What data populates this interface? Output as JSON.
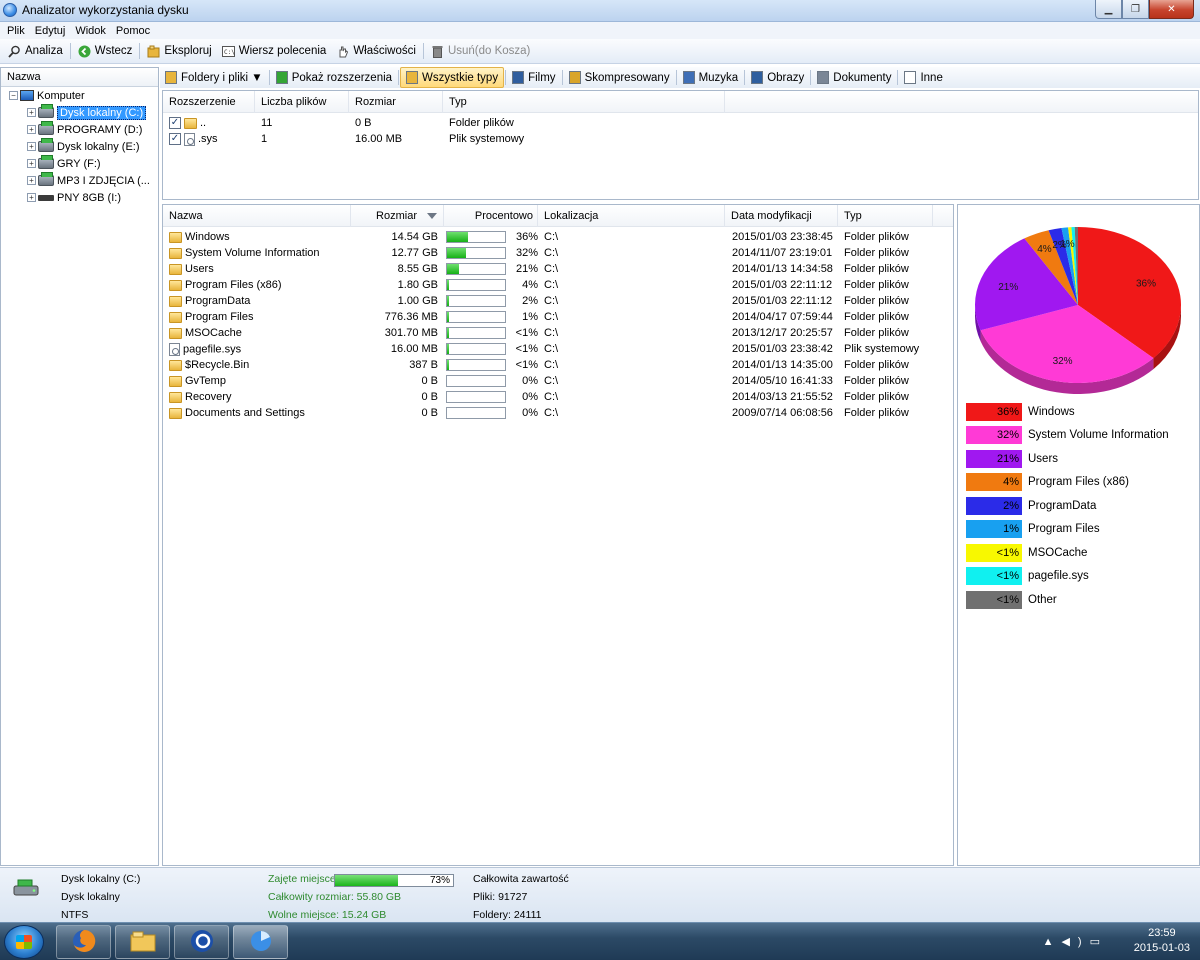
{
  "window": {
    "title": "Analizator wykorzystania dysku"
  },
  "menu": [
    "Plik",
    "Edytuj",
    "Widok",
    "Pomoc"
  ],
  "toolbar": {
    "analyze": "Analiza",
    "back": "Wstecz",
    "explore": "Eksploruj",
    "cmd": "Wiersz polecenia",
    "properties": "Właściwości",
    "delete": "Usuń(do Kosza)"
  },
  "tree": {
    "header": "Nazwa",
    "root": "Komputer",
    "drives": [
      {
        "label": "Dysk lokalny (C:)",
        "selected": true,
        "kind": "hdd"
      },
      {
        "label": "PROGRAMY (D:)",
        "selected": false,
        "kind": "hdd"
      },
      {
        "label": "Dysk lokalny (E:)",
        "selected": false,
        "kind": "hdd"
      },
      {
        "label": "GRY (F:)",
        "selected": false,
        "kind": "hdd"
      },
      {
        "label": "MP3 I ZDJĘCIA (...",
        "selected": false,
        "kind": "hdd"
      },
      {
        "label": "PNY 8GB (I:)",
        "selected": false,
        "kind": "usb"
      }
    ]
  },
  "tabs": [
    {
      "label": "Foldery i pliki ▼",
      "icon": "folder-files-icon",
      "color": "#e8b53c",
      "active": false
    },
    {
      "label": "Pokaż rozszerzenia",
      "icon": "up-arrow-icon",
      "color": "#35a535",
      "active": false
    },
    {
      "label": "Wszystkie typy",
      "icon": "folder-icon",
      "color": "#e8b53c",
      "active": true
    },
    {
      "label": "Filmy",
      "icon": "film-icon",
      "color": "#305e9e",
      "active": false
    },
    {
      "label": "Skompresowany",
      "icon": "archive-icon",
      "color": "#d9a52a",
      "active": false
    },
    {
      "label": "Muzyka",
      "icon": "music-icon",
      "color": "#3f6fb6",
      "active": false
    },
    {
      "label": "Obrazy",
      "icon": "image-icon",
      "color": "#2f5f9e",
      "active": false
    },
    {
      "label": "Dokumenty",
      "icon": "document-icon",
      "color": "#7a8696",
      "active": false
    },
    {
      "label": "Inne",
      "icon": "blank-file-icon",
      "color": "#ffffff",
      "active": false
    }
  ],
  "extensions": {
    "columns": [
      "Rozszerzenie",
      "Liczba plików",
      "Rozmiar",
      "Typ"
    ],
    "rows": [
      {
        "ext": "..",
        "count": "11",
        "size": "0 B",
        "type": "Folder plików",
        "icon": "folder-icon"
      },
      {
        "ext": ".sys",
        "count": "1",
        "size": "16.00 MB",
        "type": "Plik systemowy",
        "icon": "system-file-icon"
      }
    ]
  },
  "files": {
    "columns": [
      "Nazwa",
      "Rozmiar",
      "Procentowo",
      "Lokalizacja",
      "Data modyfikacji",
      "Typ"
    ],
    "rows": [
      {
        "name": "Windows",
        "size": "14.54 GB",
        "pct": "36%",
        "fill": 0.36,
        "loc": "C:\\",
        "date": "2015/01/03 23:38:45",
        "type": "Folder plików",
        "icon": "folder"
      },
      {
        "name": "System Volume Information",
        "size": "12.77 GB",
        "pct": "32%",
        "fill": 0.32,
        "loc": "C:\\",
        "date": "2014/11/07 23:19:01",
        "type": "Folder plików",
        "icon": "folder"
      },
      {
        "name": "Users",
        "size": "8.55 GB",
        "pct": "21%",
        "fill": 0.21,
        "loc": "C:\\",
        "date": "2014/01/13 14:34:58",
        "type": "Folder plików",
        "icon": "folder"
      },
      {
        "name": "Program Files (x86)",
        "size": "1.80 GB",
        "pct": "4%",
        "fill": 0.04,
        "loc": "C:\\",
        "date": "2015/01/03 22:11:12",
        "type": "Folder plików",
        "icon": "folder"
      },
      {
        "name": "ProgramData",
        "size": "1.00 GB",
        "pct": "2%",
        "fill": 0.02,
        "loc": "C:\\",
        "date": "2015/01/03 22:11:12",
        "type": "Folder plików",
        "icon": "folder"
      },
      {
        "name": "Program Files",
        "size": "776.36 MB",
        "pct": "1%",
        "fill": 0.01,
        "loc": "C:\\",
        "date": "2014/04/17 07:59:44",
        "type": "Folder plików",
        "icon": "folder"
      },
      {
        "name": "MSOCache",
        "size": "301.70 MB",
        "pct": "<1%",
        "fill": 0.005,
        "loc": "C:\\",
        "date": "2013/12/17 20:25:57",
        "type": "Folder plików",
        "icon": "folder"
      },
      {
        "name": "pagefile.sys",
        "size": "16.00 MB",
        "pct": "<1%",
        "fill": 0.005,
        "loc": "C:\\",
        "date": "2015/01/03 23:38:42",
        "type": "Plik systemowy",
        "icon": "file"
      },
      {
        "name": "$Recycle.Bin",
        "size": "387 B",
        "pct": "<1%",
        "fill": 0.005,
        "loc": "C:\\",
        "date": "2014/01/13 14:35:00",
        "type": "Folder plików",
        "icon": "folder"
      },
      {
        "name": "GvTemp",
        "size": "0 B",
        "pct": "0%",
        "fill": 0,
        "loc": "C:\\",
        "date": "2014/05/10 16:41:33",
        "type": "Folder plików",
        "icon": "folder"
      },
      {
        "name": "Recovery",
        "size": "0 B",
        "pct": "0%",
        "fill": 0,
        "loc": "C:\\",
        "date": "2014/03/13 21:55:52",
        "type": "Folder plików",
        "icon": "folder"
      },
      {
        "name": "Documents and Settings",
        "size": "0 B",
        "pct": "0%",
        "fill": 0,
        "loc": "C:\\",
        "date": "2009/07/14 06:08:56",
        "type": "Folder plików",
        "icon": "folder"
      }
    ]
  },
  "chart_data": {
    "type": "pie",
    "slices": [
      {
        "name": "Windows",
        "value": 36,
        "label": "36%",
        "color": "#f01818"
      },
      {
        "name": "System Volume Information",
        "value": 32,
        "label": "32%",
        "color": "#ff3ad6"
      },
      {
        "name": "Users",
        "value": 21,
        "label": "21%",
        "color": "#a018f0"
      },
      {
        "name": "Program Files (x86)",
        "value": 4,
        "label": "4%",
        "color": "#f07a10"
      },
      {
        "name": "ProgramData",
        "value": 2,
        "label": "2%",
        "color": "#2b2be8"
      },
      {
        "name": "Program Files",
        "value": 1,
        "label": "1%",
        "color": "#18a0f0"
      },
      {
        "name": "MSOCache",
        "value": 0.5,
        "label": "<1%",
        "color": "#f8f800"
      },
      {
        "name": "pagefile.sys",
        "value": 0.5,
        "label": "<1%",
        "color": "#10f0f0"
      },
      {
        "name": "Other",
        "value": 0.5,
        "label": "<1%",
        "color": "#707070"
      }
    ],
    "legend": "below"
  },
  "status": {
    "drive_name": "Dysk lokalny (C:)",
    "drive_label": "Dysk lokalny",
    "fs": "NTFS",
    "used_label": "Zajęte miejsce",
    "used_pct": "73%",
    "used_fill": 0.73,
    "total": "Całkowity rozmiar: 55.80 GB",
    "free": "Wolne miejsce: 15.24 GB",
    "content_title": "Całkowita zawartość",
    "files": "Pliki: 91727",
    "folders": "Foldery: 24111"
  },
  "taskbar": {
    "time": "23:59",
    "date": "2015-01-03"
  }
}
